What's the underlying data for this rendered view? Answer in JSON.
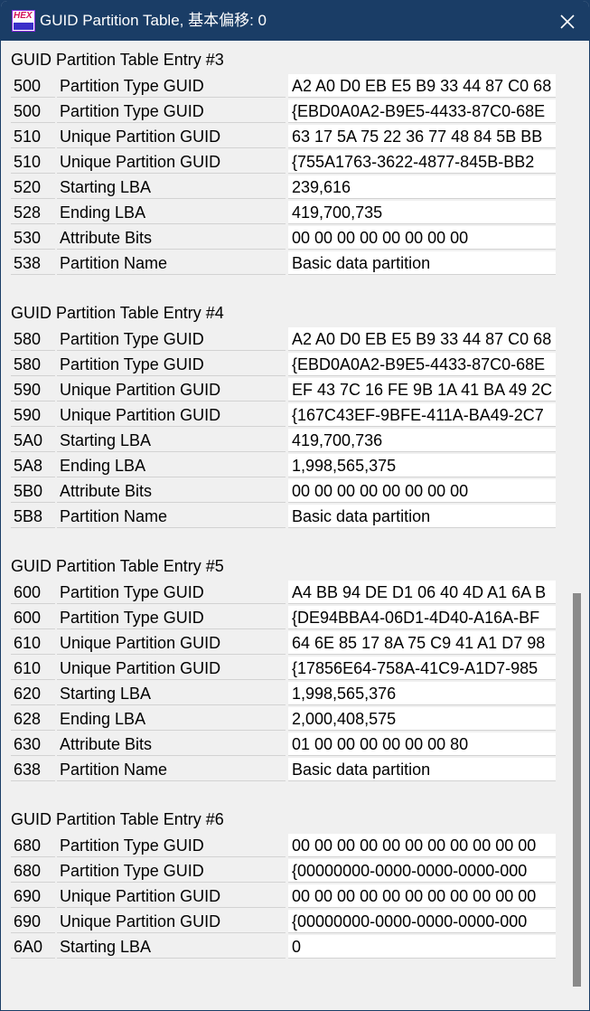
{
  "window": {
    "title": "GUID Partition Table, 基本偏移: 0",
    "icon_text": "HEX"
  },
  "sections": [
    {
      "title": "GUID Partition Table Entry #3",
      "rows": [
        {
          "offset": "500",
          "desc": "Partition Type GUID",
          "value": "A2 A0 D0 EB E5 B9 33 44 87 C0 68"
        },
        {
          "offset": "500",
          "desc": "Partition Type GUID",
          "value": "{EBD0A0A2-B9E5-4433-87C0-68E"
        },
        {
          "offset": "510",
          "desc": "Unique Partition GUID",
          "value": "63 17 5A 75 22 36 77 48 84 5B BB"
        },
        {
          "offset": "510",
          "desc": "Unique Partition GUID",
          "value": "{755A1763-3622-4877-845B-BB2"
        },
        {
          "offset": "520",
          "desc": "Starting LBA",
          "value": "239,616"
        },
        {
          "offset": "528",
          "desc": "Ending LBA",
          "value": "419,700,735"
        },
        {
          "offset": "530",
          "desc": "Attribute Bits",
          "value": "00 00 00 00 00 00 00 00"
        },
        {
          "offset": "538",
          "desc": "Partition Name",
          "value": "Basic data partition"
        }
      ]
    },
    {
      "title": "GUID Partition Table Entry #4",
      "rows": [
        {
          "offset": "580",
          "desc": "Partition Type GUID",
          "value": "A2 A0 D0 EB E5 B9 33 44 87 C0 68"
        },
        {
          "offset": "580",
          "desc": "Partition Type GUID",
          "value": "{EBD0A0A2-B9E5-4433-87C0-68E"
        },
        {
          "offset": "590",
          "desc": "Unique Partition GUID",
          "value": "EF 43 7C 16 FE 9B 1A 41 BA 49 2C"
        },
        {
          "offset": "590",
          "desc": "Unique Partition GUID",
          "value": "{167C43EF-9BFE-411A-BA49-2C7"
        },
        {
          "offset": "5A0",
          "desc": "Starting LBA",
          "value": "419,700,736"
        },
        {
          "offset": "5A8",
          "desc": "Ending LBA",
          "value": "1,998,565,375"
        },
        {
          "offset": "5B0",
          "desc": "Attribute Bits",
          "value": "00 00 00 00 00 00 00 00"
        },
        {
          "offset": "5B8",
          "desc": "Partition Name",
          "value": "Basic data partition"
        }
      ]
    },
    {
      "title": "GUID Partition Table Entry #5",
      "rows": [
        {
          "offset": "600",
          "desc": "Partition Type GUID",
          "value": "A4 BB 94 DE D1 06 40 4D A1 6A B"
        },
        {
          "offset": "600",
          "desc": "Partition Type GUID",
          "value": "{DE94BBA4-06D1-4D40-A16A-BF"
        },
        {
          "offset": "610",
          "desc": "Unique Partition GUID",
          "value": "64 6E 85 17 8A 75 C9 41 A1 D7 98"
        },
        {
          "offset": "610",
          "desc": "Unique Partition GUID",
          "value": "{17856E64-758A-41C9-A1D7-985"
        },
        {
          "offset": "620",
          "desc": "Starting LBA",
          "value": "1,998,565,376"
        },
        {
          "offset": "628",
          "desc": "Ending LBA",
          "value": "2,000,408,575"
        },
        {
          "offset": "630",
          "desc": "Attribute Bits",
          "value": "01 00 00 00 00 00 00 80"
        },
        {
          "offset": "638",
          "desc": "Partition Name",
          "value": "Basic data partition"
        }
      ]
    },
    {
      "title": "GUID Partition Table Entry #6",
      "rows": [
        {
          "offset": "680",
          "desc": "Partition Type GUID",
          "value": "00 00 00 00 00 00 00 00 00 00 00"
        },
        {
          "offset": "680",
          "desc": "Partition Type GUID",
          "value": "{00000000-0000-0000-0000-000"
        },
        {
          "offset": "690",
          "desc": "Unique Partition GUID",
          "value": "00 00 00 00 00 00 00 00 00 00 00"
        },
        {
          "offset": "690",
          "desc": "Unique Partition GUID",
          "value": "{00000000-0000-0000-0000-000"
        },
        {
          "offset": "6A0",
          "desc": "Starting LBA",
          "value": "0"
        }
      ]
    }
  ],
  "colors": {
    "titlebar": "#1a3d66",
    "content_bg": "#f0f0f0",
    "value_bg": "#ffffff",
    "scroll_thumb": "#8a8a8a"
  }
}
